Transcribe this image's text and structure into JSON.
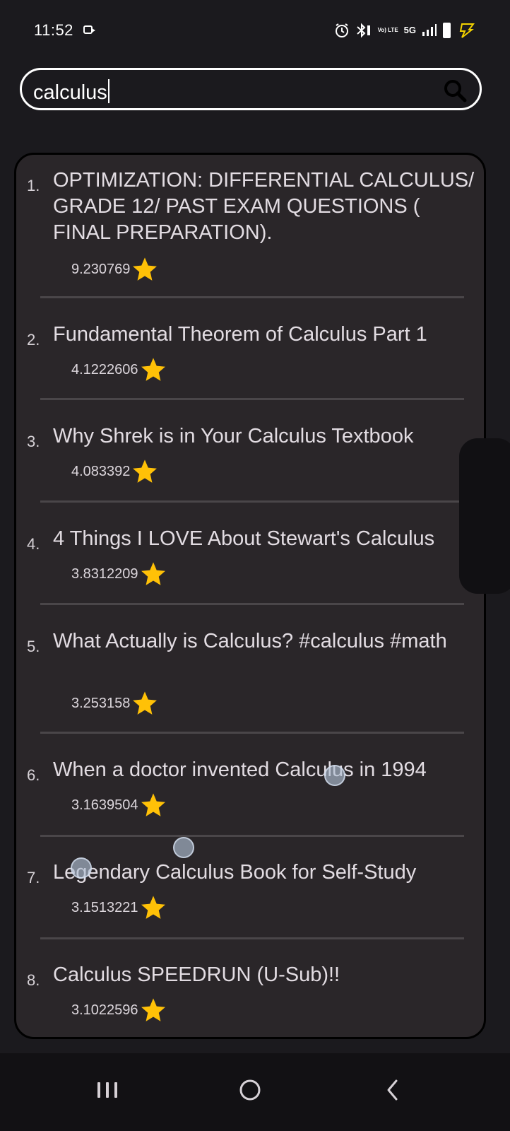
{
  "status_bar": {
    "time": "11:52",
    "network": "5G",
    "volte": "Vo) LTE",
    "icons": [
      "camera-icon",
      "alarm-icon",
      "bluetooth-icon",
      "volte-icon",
      "signal-icon",
      "battery-icon",
      "charging-icon"
    ]
  },
  "search": {
    "value": "calculus",
    "icon": "search-icon"
  },
  "results": [
    {
      "num": "1.",
      "title": "OPTIMIZATION: DIFFERENTIAL CALCULUS/ GRADE 12/ PAST EXAM QUESTIONS ( FINAL PREPARATION).",
      "rating": "9.230769"
    },
    {
      "num": "2.",
      "title": "Fundamental Theorem of Calculus Part 1",
      "rating": "4.1222606"
    },
    {
      "num": "3.",
      "title": "Why Shrek is in Your Calculus Textbook",
      "rating": "4.083392"
    },
    {
      "num": "4.",
      "title": "4 Things I LOVE About Stewart's Calculus",
      "rating": "3.8312209"
    },
    {
      "num": "5.",
      "title": "What Actually is Calculus? #calculus #math",
      "rating": "3.253158"
    },
    {
      "num": "6.",
      "title": "When a doctor invented Calculus in 1994",
      "rating": "3.1639504"
    },
    {
      "num": "7.",
      "title": "Legendary Calculus Book for Self-Study",
      "rating": "3.1513221"
    },
    {
      "num": "8.",
      "title": "Calculus SPEEDRUN (U-Sub)!!",
      "rating": "3.1022596"
    }
  ],
  "colors": {
    "background": "#1b1a1e",
    "card": "#2a2629",
    "star": "#ffc107",
    "divider": "#4a4649"
  },
  "nav": {
    "icons": [
      "menu-icon",
      "home-icon",
      "back-icon"
    ]
  }
}
